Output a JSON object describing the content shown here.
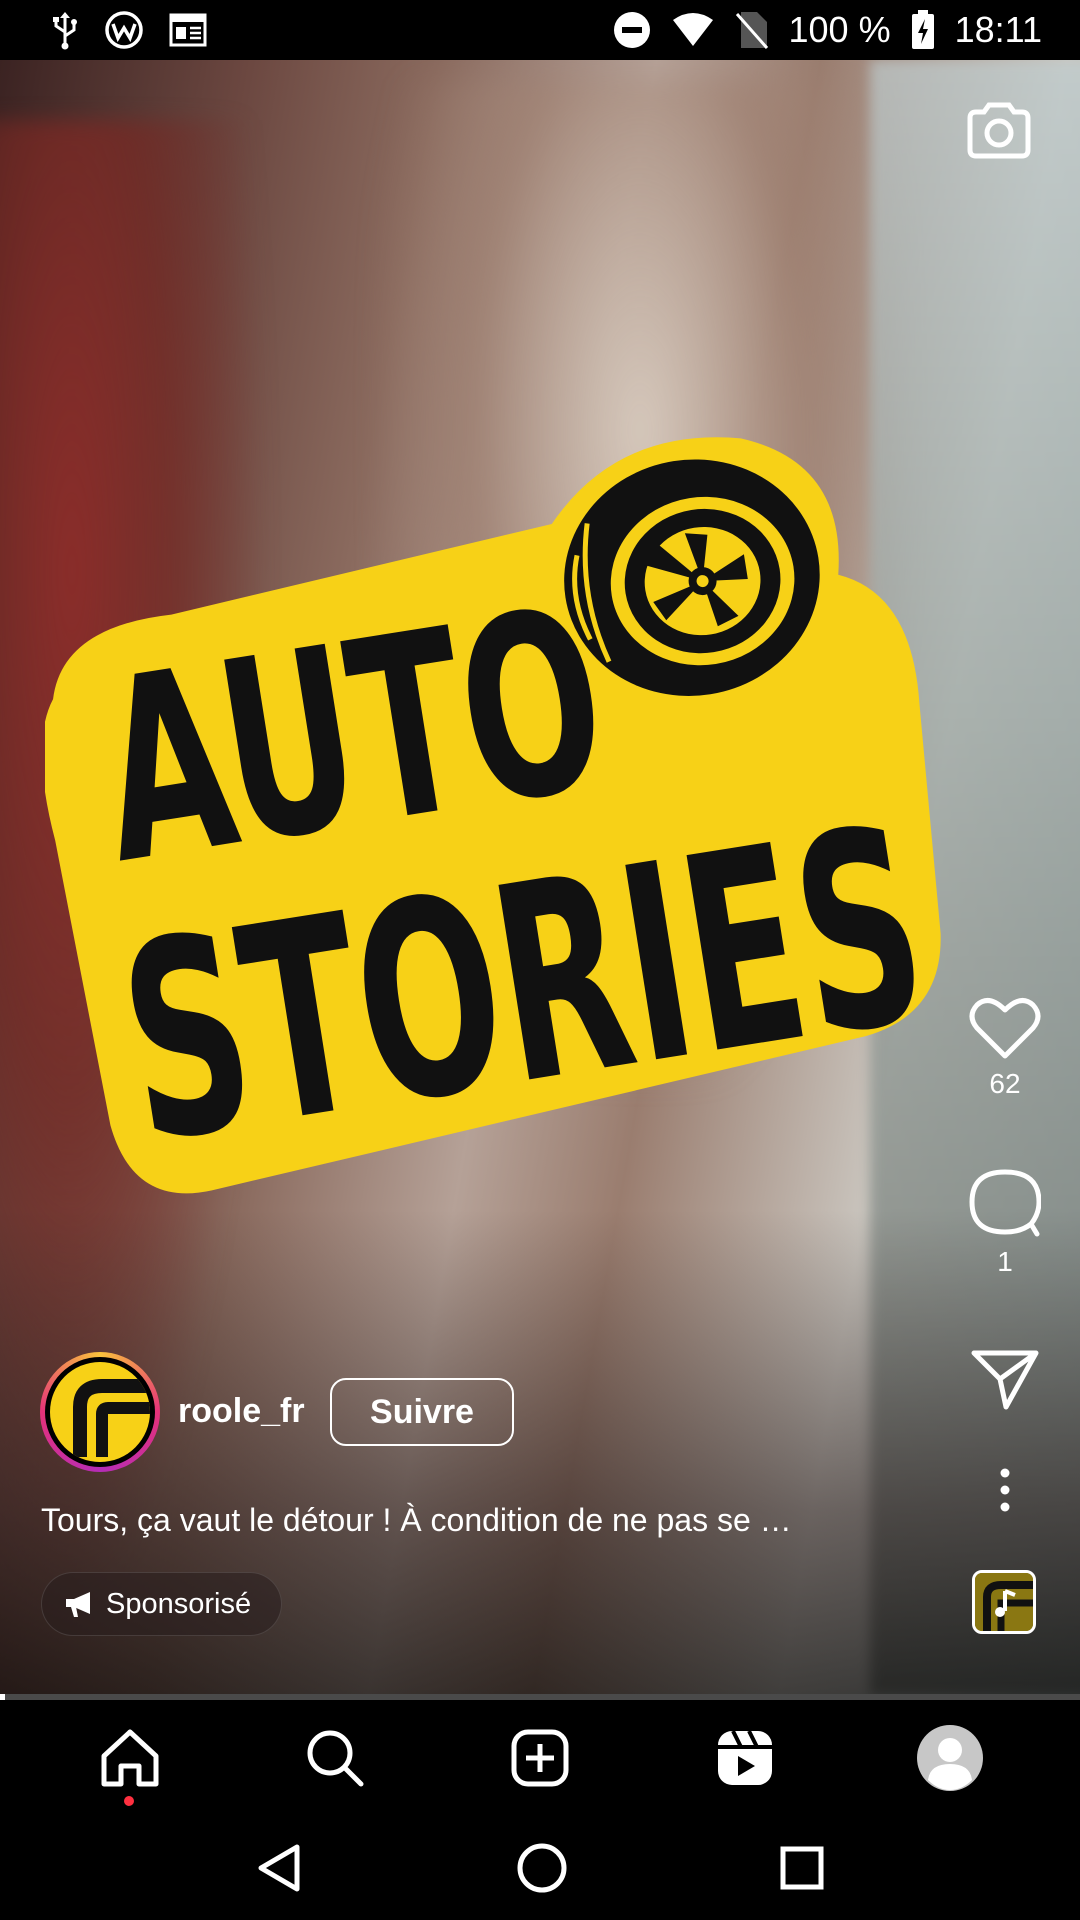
{
  "status_bar": {
    "battery_percent": "100 %",
    "time": "18:11",
    "icons": [
      "usb-icon",
      "vpn-icon",
      "news-icon",
      "do-not-disturb-icon",
      "wifi-icon",
      "no-sim-icon",
      "battery-charging-icon"
    ]
  },
  "reel": {
    "logo_line1": "AUTO",
    "logo_line2": "STORIES",
    "account": {
      "username": "roole_fr",
      "follow_label": "Suivre"
    },
    "caption": "Tours, ça vaut le détour ! À condition de ne pas se …",
    "sponsored_label": "Sponsorisé",
    "likes_count": "62",
    "comments_count": "1",
    "progress": 0.005,
    "colors": {
      "logo_yellow": "#f7d117",
      "logo_black": "#111111",
      "notification": "#ff3040"
    }
  },
  "bottom_nav": {
    "items": [
      "home-icon",
      "search-icon",
      "create-icon",
      "reels-icon",
      "profile-avatar"
    ]
  },
  "system_nav": {
    "items": [
      "back-icon",
      "home-circle-icon",
      "recents-icon"
    ]
  }
}
